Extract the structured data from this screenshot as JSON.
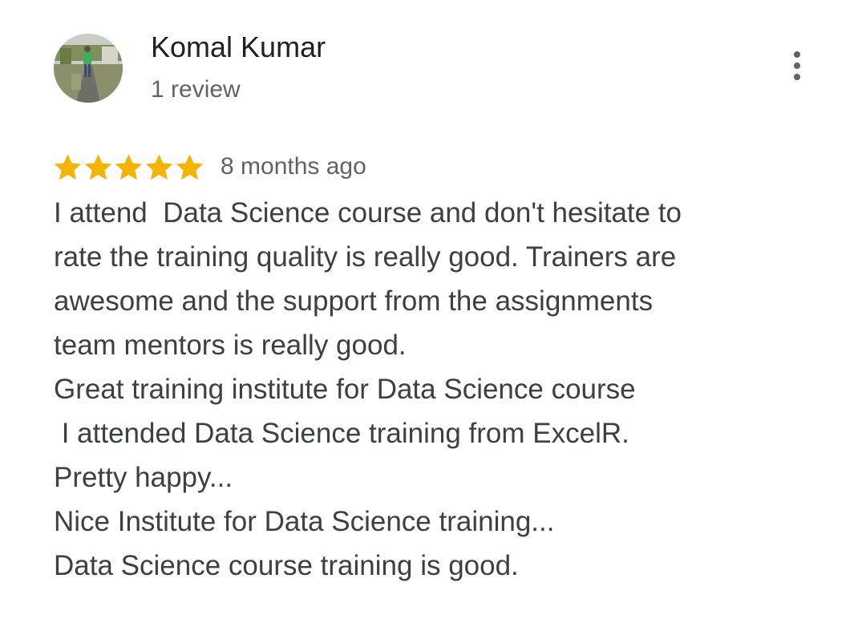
{
  "reviewer": {
    "name": "Komal Kumar",
    "review_count": "1 review",
    "avatar_icon": "user-photo-avatar"
  },
  "menu": {
    "icon": "more-vertical-icon"
  },
  "rating": {
    "stars": 5,
    "max_stars": 5,
    "star_color": "#f4b400",
    "date": "8 months ago"
  },
  "review": {
    "lines": [
      "I attend  Data Science course and don't hesitate to",
      "rate the training quality is really good. Trainers are",
      "awesome and the support from the assignments",
      "team mentors is really good.",
      "Great training institute for Data Science course",
      " I attended Data Science training from ExcelR.",
      "Pretty happy...",
      "Nice Institute for Data Science training...",
      "Data Science course training is good."
    ]
  }
}
